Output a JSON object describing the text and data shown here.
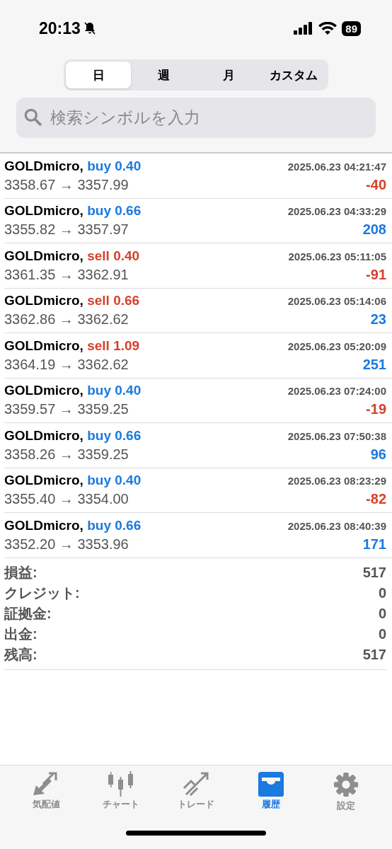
{
  "status_bar": {
    "time": "20:13",
    "battery": "89"
  },
  "period_tabs": [
    {
      "label": "日",
      "selected": true
    },
    {
      "label": "週",
      "selected": false
    },
    {
      "label": "月",
      "selected": false
    },
    {
      "label": "カスタム",
      "selected": false
    }
  ],
  "search": {
    "placeholder": "検索シンボルを入力"
  },
  "deals": [
    {
      "symbol": "GOLDmicro,",
      "side": "buy",
      "volume": "0.40",
      "color": "#1a7ae0",
      "time": "2025.06.23 04:21:47",
      "prices": "3358.67 → 3357.99",
      "profit": "-40",
      "loss": true
    },
    {
      "symbol": "GOLDmicro,",
      "side": "buy",
      "volume": "0.66",
      "color": "#1a7ae0",
      "time": "2025.06.23 04:33:29",
      "prices": "3355.82 → 3357.97",
      "profit": "208",
      "loss": false
    },
    {
      "symbol": "GOLDmicro,",
      "side": "sell",
      "volume": "0.40",
      "color": "#d8402b",
      "time": "2025.06.23 05:11:05",
      "prices": "3361.35 → 3362.91",
      "profit": "-91",
      "loss": true
    },
    {
      "symbol": "GOLDmicro,",
      "side": "sell",
      "volume": "0.66",
      "color": "#d8402b",
      "time": "2025.06.23 05:14:06",
      "prices": "3362.86 → 3362.62",
      "profit": "23",
      "loss": false
    },
    {
      "symbol": "GOLDmicro,",
      "side": "sell",
      "volume": "1.09",
      "color": "#d8402b",
      "time": "2025.06.23 05:20:09",
      "prices": "3364.19 → 3362.62",
      "profit": "251",
      "loss": false
    },
    {
      "symbol": "GOLDmicro,",
      "side": "buy",
      "volume": "0.40",
      "color": "#1a7ae0",
      "time": "2025.06.23 07:24:00",
      "prices": "3359.57 → 3359.25",
      "profit": "-19",
      "loss": true
    },
    {
      "symbol": "GOLDmicro,",
      "side": "buy",
      "volume": "0.66",
      "color": "#1a7ae0",
      "time": "2025.06.23 07:50:38",
      "prices": "3358.26 → 3359.25",
      "profit": "96",
      "loss": false
    },
    {
      "symbol": "GOLDmicro,",
      "side": "buy",
      "volume": "0.40",
      "color": "#1a7ae0",
      "time": "2025.06.23 08:23:29",
      "prices": "3355.40 → 3354.00",
      "profit": "-82",
      "loss": true
    },
    {
      "symbol": "GOLDmicro,",
      "side": "buy",
      "volume": "0.66",
      "color": "#1a7ae0",
      "time": "2025.06.23 08:40:39",
      "prices": "3352.20 → 3353.96",
      "profit": "171",
      "loss": false
    }
  ],
  "summary": [
    {
      "label": "損益:",
      "value": "517"
    },
    {
      "label": "クレジット:",
      "value": "0"
    },
    {
      "label": "証拠金:",
      "value": "0"
    },
    {
      "label": "出金:",
      "value": "0"
    },
    {
      "label": "残高:",
      "value": "517"
    }
  ],
  "tab_bar": [
    {
      "kind": "quotes",
      "label": "気配値",
      "selected": false
    },
    {
      "kind": "chart",
      "label": "チャート",
      "selected": false
    },
    {
      "kind": "trade",
      "label": "トレード",
      "selected": false
    },
    {
      "kind": "history",
      "label": "履歴",
      "selected": true
    },
    {
      "kind": "settings",
      "label": "設定",
      "selected": false
    }
  ]
}
